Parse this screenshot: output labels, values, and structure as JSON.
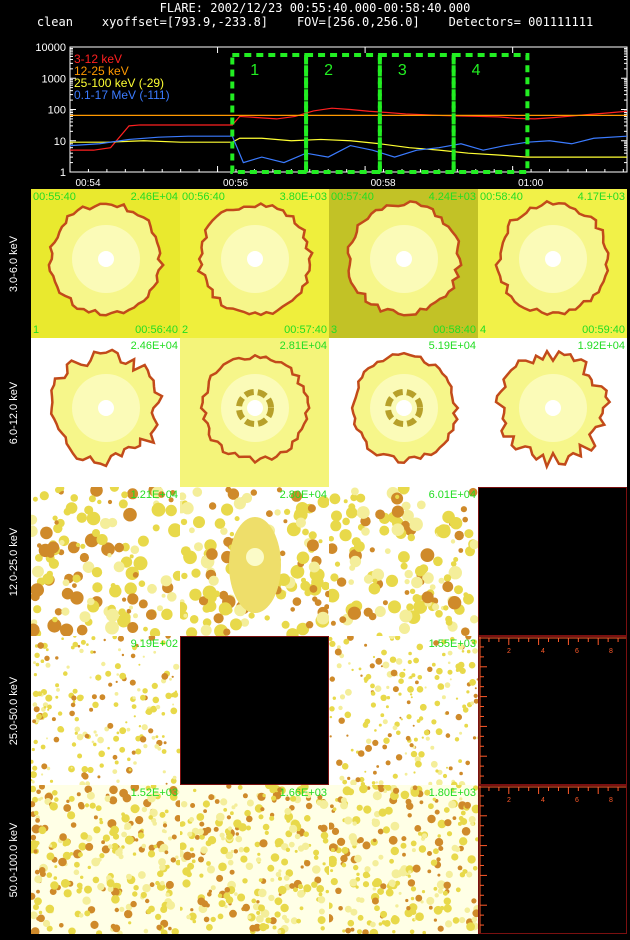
{
  "header": {
    "title": "FLARE: 2002/12/23 00:55:40.000-00:58:40.000",
    "method": "clean",
    "xyoffset": "xyoffset=[793.9,-233.8]",
    "fov": "FOV=[256.0,256.0]",
    "detectors": "Detectors= 001111111"
  },
  "colors": {
    "band_3_12": "#ff2020",
    "band_12_25": "#ff9900",
    "band_25_100": "#ffff33",
    "band_100k": "#3b7bff",
    "interval_box": "#22ee22",
    "tile_label": "#22dd22",
    "blank_axes": "#ff5a2a"
  },
  "chart_data": {
    "type": "line",
    "title": "FLARE: 2002/12/23 00:55:40.000-00:58:40.000",
    "yscale": "log",
    "ylim": [
      1,
      10000
    ],
    "y_ticks": [
      "10000",
      "1000",
      "100",
      "10",
      "1"
    ],
    "x_ticks": [
      "00:54",
      "00:56",
      "00:58",
      "01:00"
    ],
    "legend_position": "top-left",
    "series": [
      {
        "name": "3-12 keV",
        "color": "#ff2020",
        "x": [
          0,
          0.32,
          0.55,
          0.8,
          0.95,
          2.2,
          2.3,
          2.55,
          2.8,
          3.05,
          3.3,
          3.55,
          3.8,
          4.05,
          4.3,
          4.55,
          4.8,
          5.05,
          5.3,
          5.55,
          5.8,
          6.05,
          6.3,
          6.55,
          6.8,
          7.05,
          7.3,
          7.55
        ],
        "values": [
          5,
          5,
          6,
          30,
          32,
          32,
          60,
          55,
          50,
          60,
          90,
          110,
          100,
          88,
          80,
          72,
          68,
          64,
          62,
          60,
          58,
          52,
          50,
          55,
          62,
          70,
          78,
          88
        ]
      },
      {
        "name": "12-25 keV",
        "color": "#ff9900",
        "x": [
          0,
          2.2,
          7.55
        ],
        "values": [
          65,
          65,
          65
        ]
      },
      {
        "name": "25-100 keV (-29)",
        "color": "#ffff33",
        "x": [
          0,
          0.5,
          1,
          1.5,
          2.2,
          2.3,
          2.6,
          3.0,
          3.4,
          3.8,
          4.2,
          4.6,
          5.0,
          5.4,
          5.8,
          6.2,
          6.6,
          7.0,
          7.55
        ],
        "values": [
          9,
          9,
          10,
          9,
          9,
          12,
          12,
          10,
          11,
          10,
          8,
          6,
          5,
          4,
          3.5,
          3,
          3,
          3,
          3
        ]
      },
      {
        "name": "0.1-17 MeV (-111)",
        "color": "#3b7bff",
        "x": [
          0,
          0.4,
          0.8,
          1.2,
          1.6,
          2.0,
          2.2,
          2.35,
          2.6,
          2.9,
          3.2,
          3.5,
          3.8,
          4.1,
          4.4,
          4.7,
          5.0,
          5.3,
          5.6,
          5.9,
          6.2,
          6.5,
          6.8,
          7.1,
          7.55
        ],
        "values": [
          7,
          8,
          11,
          13,
          14,
          14,
          14,
          2,
          3,
          2,
          4,
          3,
          7,
          5,
          3,
          5,
          6,
          8,
          5,
          7,
          9,
          10,
          8,
          12,
          14
        ]
      }
    ],
    "intervals": [
      {
        "label": "1",
        "start": 2.2,
        "end": 3.2
      },
      {
        "label": "2",
        "start": 3.2,
        "end": 4.2
      },
      {
        "label": "3",
        "start": 4.2,
        "end": 5.2
      },
      {
        "label": "4",
        "start": 5.2,
        "end": 6.2
      }
    ]
  },
  "grid": {
    "rows": [
      {
        "label": "3.0-6.0 keV",
        "tiles": [
          {
            "type": "image",
            "style": "disk_full",
            "bg": "#e9e92e",
            "max": "2.46E+04",
            "time_start": "00:55:40",
            "interval": "1",
            "time_end": "00:56:40"
          },
          {
            "type": "image",
            "style": "disk_full",
            "bg": "#efef3c",
            "max": "3.80E+03",
            "time_start": "00:56:40",
            "interval": "2",
            "time_end": "00:57:40"
          },
          {
            "type": "image",
            "style": "disk_full",
            "bg": "#c2c226",
            "max": "4.24E+03",
            "time_start": "00:57:40",
            "interval": "3",
            "time_end": "00:58:40"
          },
          {
            "type": "image",
            "style": "disk_full",
            "bg": "#f1f148",
            "max": "4.17E+03",
            "time_start": "00:58:40",
            "interval": "4",
            "time_end": "00:59:40"
          }
        ]
      },
      {
        "label": "6.0-12.0 keV",
        "tiles": [
          {
            "type": "image",
            "style": "disk_white",
            "bg": "#ffffff",
            "max": "2.46E+04"
          },
          {
            "type": "image",
            "style": "disk_ring",
            "bg": "#f4f47a",
            "max": "2.81E+04"
          },
          {
            "type": "image",
            "style": "disk_ring",
            "bg": "#ffffff",
            "max": "5.19E+04"
          },
          {
            "type": "image",
            "style": "disk_white",
            "bg": "#ffffff",
            "max": "1.92E+04"
          }
        ]
      },
      {
        "label": "12.0-25.0 keV",
        "tiles": [
          {
            "type": "image",
            "style": "noise",
            "bg": "#ffffff",
            "max": "1.21E+04"
          },
          {
            "type": "image",
            "style": "noise_blob",
            "bg": "#ffffff",
            "max": "2.80E+04"
          },
          {
            "type": "image",
            "style": "noise",
            "bg": "#ffffff",
            "max": "6.01E+04"
          },
          {
            "type": "blank",
            "axes": false
          }
        ]
      },
      {
        "label": "25.0-50.0 keV",
        "tiles": [
          {
            "type": "image",
            "style": "noise_fine",
            "bg": "#ffffff",
            "max": "9.19E+02"
          },
          {
            "type": "blank",
            "axes": false
          },
          {
            "type": "image",
            "style": "noise_fine",
            "bg": "#ffffff",
            "max": "1.55E+03"
          },
          {
            "type": "blank",
            "axes": true
          }
        ]
      },
      {
        "label": "50.0-100.0 keV",
        "tiles": [
          {
            "type": "image",
            "style": "speckle",
            "bg": "#ffffe6",
            "max": "1.52E+03"
          },
          {
            "type": "image",
            "style": "speckle",
            "bg": "#ffffe6",
            "max": "1.66E+03"
          },
          {
            "type": "image",
            "style": "speckle",
            "bg": "#ffffe6",
            "max": "1.80E+03"
          },
          {
            "type": "blank",
            "axes": true
          }
        ]
      }
    ],
    "axis_ticks": [
      "2",
      "4",
      "6",
      "8"
    ]
  }
}
